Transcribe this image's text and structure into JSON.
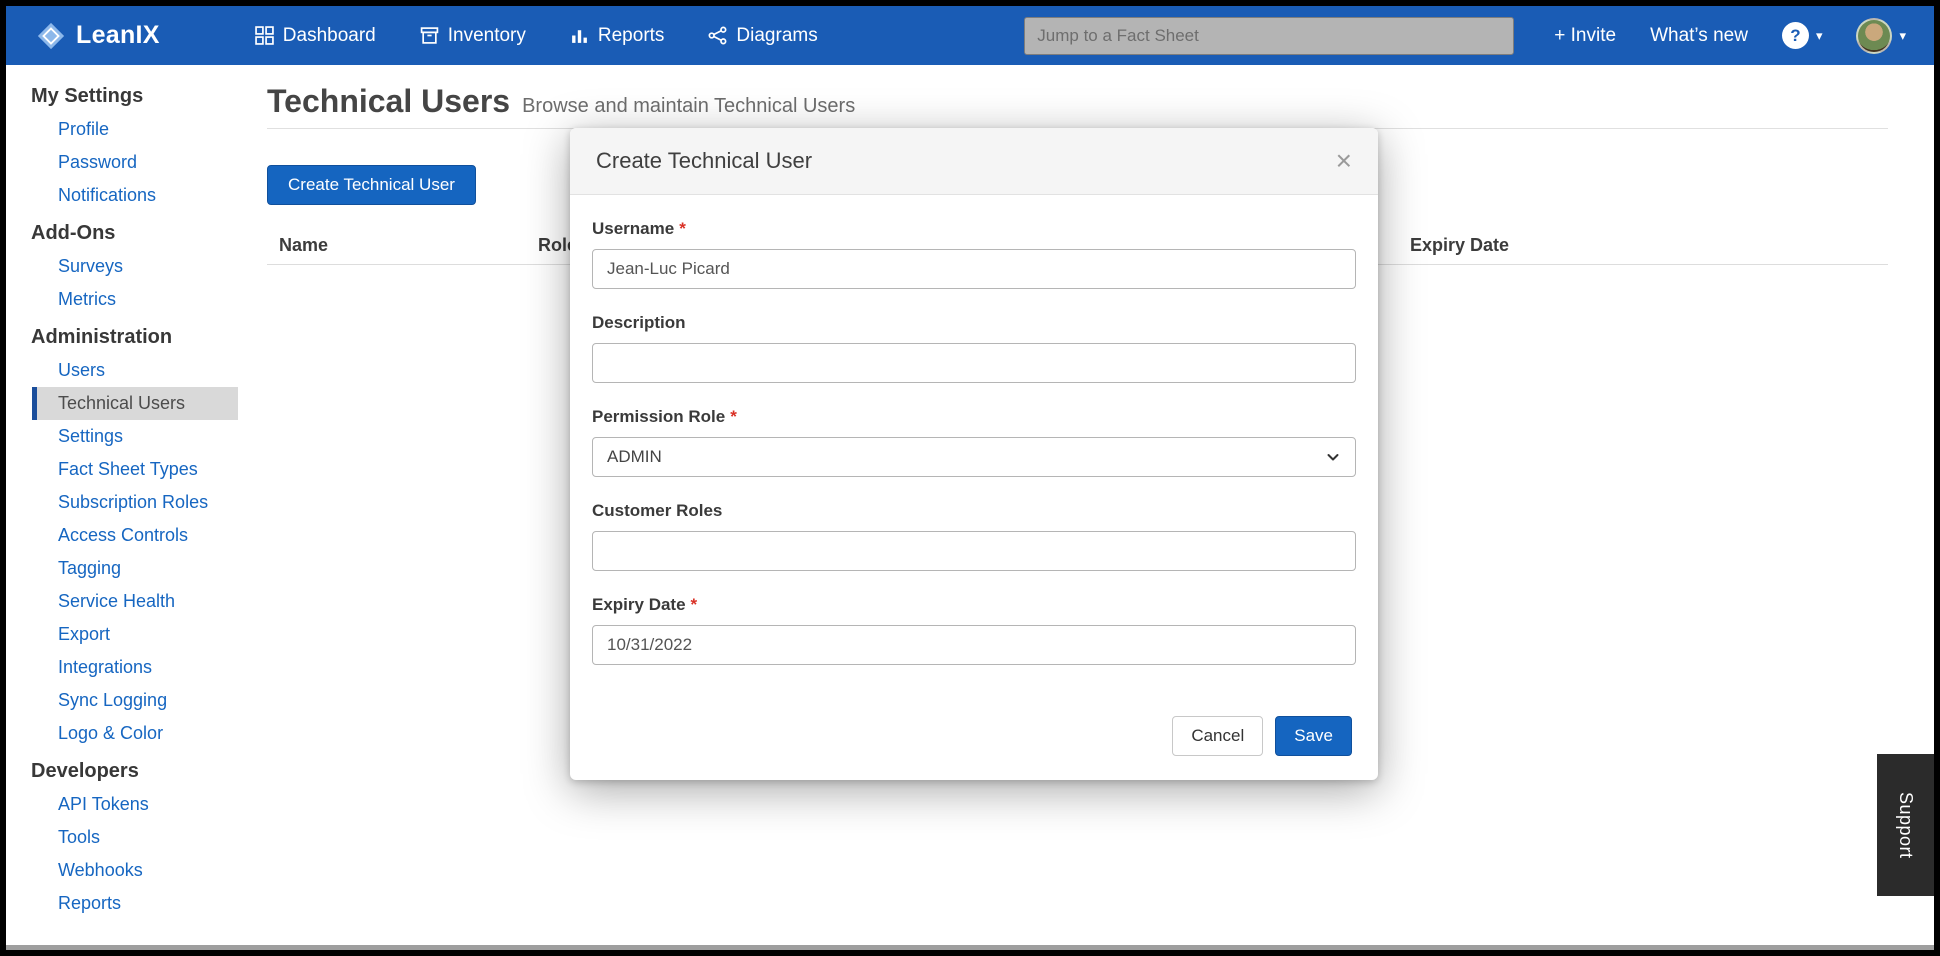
{
  "colors": {
    "navbar_bg": "#1a5cb5",
    "link_blue": "#1666c1",
    "primary_button": "#1565c0",
    "required_red": "#d93025",
    "active_item_bg": "#d9d9d9",
    "active_item_bar": "#1b4e9b",
    "support_bg": "#2b2b2b"
  },
  "navbar": {
    "brand": "LeanIX",
    "items": [
      {
        "label": "Dashboard",
        "icon": "dashboard-grid-icon"
      },
      {
        "label": "Inventory",
        "icon": "inventory-box-icon"
      },
      {
        "label": "Reports",
        "icon": "reports-chart-icon"
      },
      {
        "label": "Diagrams",
        "icon": "diagrams-network-icon"
      }
    ],
    "search": {
      "placeholder": "Jump to a Fact Sheet"
    },
    "invite": "+ Invite",
    "whats_new": "What’s new",
    "help_icon": "?",
    "caret": "▾"
  },
  "sidebar": {
    "sections": [
      {
        "title": "My Settings",
        "items": [
          "Profile",
          "Password",
          "Notifications"
        ]
      },
      {
        "title": "Add-Ons",
        "items": [
          "Surveys",
          "Metrics"
        ]
      },
      {
        "title": "Administration",
        "items": [
          "Users",
          "Technical Users",
          "Settings",
          "Fact Sheet Types",
          "Subscription Roles",
          "Access Controls",
          "Tagging",
          "Service Health",
          "Export",
          "Integrations",
          "Sync Logging",
          "Logo & Color"
        ]
      },
      {
        "title": "Developers",
        "items": [
          "API Tokens",
          "Tools",
          "Webhooks",
          "Reports"
        ]
      }
    ],
    "active_item": "Technical Users"
  },
  "main": {
    "title": "Technical Users",
    "subtitle": "Browse and maintain Technical Users",
    "create_button": "Create Technical User",
    "table": {
      "headers": [
        "Name",
        "Role",
        "Expiry Date"
      ]
    }
  },
  "modal": {
    "title": "Create Technical User",
    "close": "×",
    "required_marker": "*",
    "fields": {
      "username": {
        "label": "Username",
        "required": true,
        "value": "Jean-Luc Picard"
      },
      "description": {
        "label": "Description",
        "required": false,
        "value": ""
      },
      "permission_role": {
        "label": "Permission Role",
        "required": true,
        "value": "ADMIN"
      },
      "customer_roles": {
        "label": "Customer Roles",
        "required": false,
        "value": ""
      },
      "expiry_date": {
        "label": "Expiry Date",
        "required": true,
        "value": "10/31/2022"
      }
    },
    "cancel": "Cancel",
    "save": "Save"
  },
  "support_tab": "Support"
}
